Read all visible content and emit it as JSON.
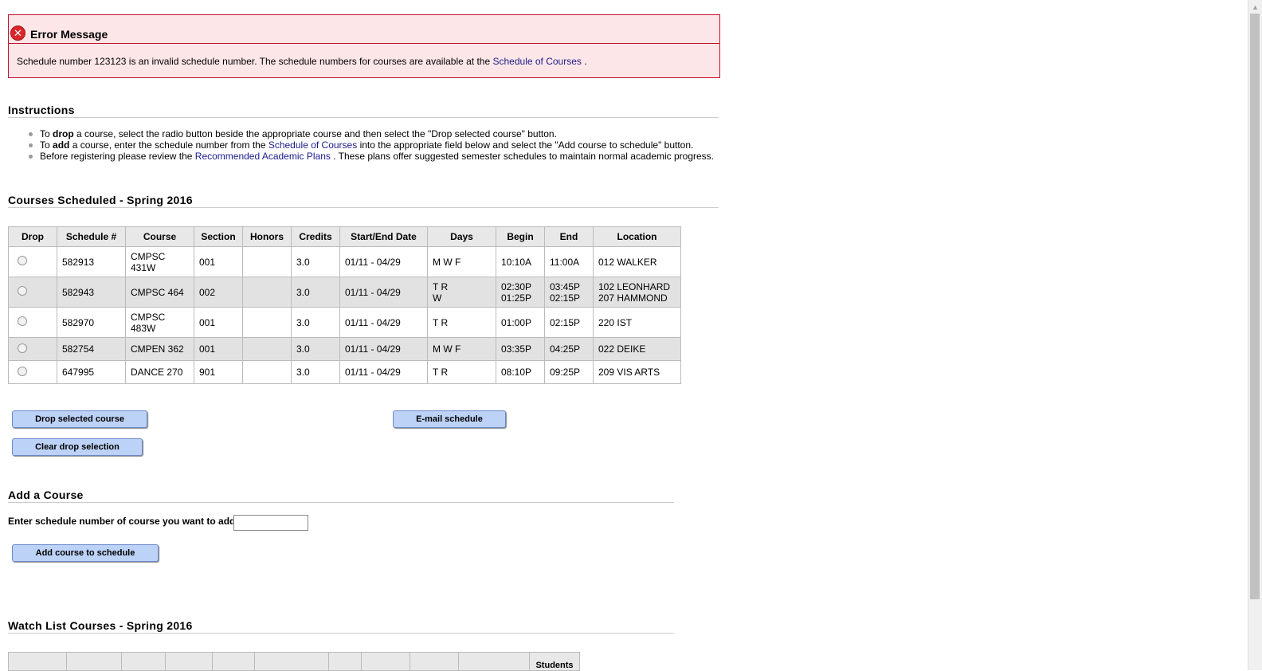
{
  "error": {
    "title": "Error Message",
    "icon": "error-icon",
    "message_prefix": "Schedule number 123123 is an invalid schedule number. The schedule numbers for courses are available at the",
    "message_link": "Schedule of Courses",
    "message_suffix": "."
  },
  "instructions": {
    "title": "Instructions",
    "items": [
      {
        "pre": "To ",
        "bold": "drop",
        "post": " a course, select the radio button beside the appropriate course and then select the \"Drop selected course\" button.",
        "link": "",
        "after": ""
      },
      {
        "pre": "To ",
        "bold": "add",
        "post": " a course, enter the schedule number from the ",
        "link": "Schedule of Courses",
        "after": " into the appropriate field below and select the \"Add course to schedule\" button."
      },
      {
        "pre": "Before registering please review the ",
        "bold": "",
        "post": "",
        "link": "Recommended Academic Plans",
        "after": " . These plans offer suggested semester schedules to maintain normal academic progress."
      }
    ]
  },
  "scheduled": {
    "title": "Courses Scheduled - Spring 2016",
    "headers": [
      "Drop",
      "Schedule #",
      "Course",
      "Section",
      "Honors",
      "Credits",
      "Start/End Date",
      "Days",
      "Begin",
      "End",
      "Location"
    ],
    "rows": [
      {
        "schedule": "582913",
        "course": "CMPSC 431W",
        "section": "001",
        "honors": "",
        "credits": "3.0",
        "dates": "01/11 - 04/29",
        "days": "M W F",
        "begin": "10:10A",
        "end": "11:00A",
        "location": "012 WALKER"
      },
      {
        "schedule": "582943",
        "course": "CMPSC 464",
        "section": "002",
        "honors": "",
        "credits": "3.0",
        "dates": "01/11 - 04/29",
        "days": "T R\nW",
        "begin": "02:30P\n01:25P",
        "end": "03:45P\n02:15P",
        "location": "102 LEONHARD\n207 HAMMOND"
      },
      {
        "schedule": "582970",
        "course": "CMPSC 483W",
        "section": "001",
        "honors": "",
        "credits": "3.0",
        "dates": "01/11 - 04/29",
        "days": "T R",
        "begin": "01:00P",
        "end": "02:15P",
        "location": "220 IST"
      },
      {
        "schedule": "582754",
        "course": "CMPEN 362",
        "section": "001",
        "honors": "",
        "credits": "3.0",
        "dates": "01/11 - 04/29",
        "days": "M W F",
        "begin": "03:35P",
        "end": "04:25P",
        "location": "022 DEIKE"
      },
      {
        "schedule": "647995",
        "course": "DANCE 270",
        "section": "901",
        "honors": "",
        "credits": "3.0",
        "dates": "01/11 - 04/29",
        "days": "T R",
        "begin": "08:10P",
        "end": "09:25P",
        "location": "209 VIS ARTS"
      }
    ]
  },
  "buttons": {
    "drop": "Drop selected course",
    "clear": "Clear drop selection",
    "email": "E-mail schedule",
    "add": "Add course to schedule"
  },
  "add_course": {
    "title": "Add a Course",
    "label": "Enter schedule number of course you want to add:",
    "value": ""
  },
  "watch": {
    "title": "Watch List Courses - Spring 2016",
    "last_header": "Students"
  }
}
